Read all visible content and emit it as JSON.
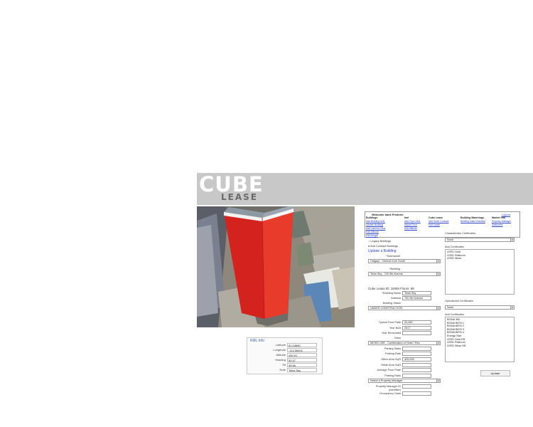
{
  "brand": {
    "word1": "CUBE",
    "word2": "LEASE"
  },
  "kml": {
    "title": "KML Info",
    "rows": [
      {
        "label": "Latitude",
        "value": "51.04660"
      },
      {
        "label": "Longitude",
        "value": "-114.06401"
      },
      {
        "label": "Altitude",
        "value": "490.91"
      },
      {
        "label": "Heading",
        "value": "50.47"
      },
      {
        "label": "Tilt",
        "value": "45.66"
      },
      {
        "label": "Note",
        "value": "Telus Sky"
      }
    ]
  },
  "welcome": {
    "title": "Welcome back Frederic",
    "logout": "Logout",
    "columns": [
      {
        "heading": "Buildings",
        "links": [
          "Add Building KML",
          "Update Building",
          "Add Camera View",
          "Edit Altitude",
          "Edit Height"
        ]
      },
      {
        "heading": "kml",
        "links": [
          "Add Floor KML",
          "Adjust Floor",
          "Edit Altitude"
        ]
      },
      {
        "heading": "Cube Lease",
        "links": [
          "Add Suite Contract",
          "Edit Lease"
        ]
      },
      {
        "heading": "Building Matchings",
        "links": [
          "Building Data Checklist"
        ]
      },
      {
        "heading": "Market Info",
        "links": [
          "Property Manager",
          "Statement"
        ]
      }
    ]
  },
  "form": {
    "radio_legacy": "Legacy Buildings",
    "radio_cube": "Add Contract Buildings",
    "update_link": "Update a Building",
    "submarket_label": "*Submarket",
    "submarket_value": "Calgary - Central Core South",
    "building_label": "*Building",
    "building_value": "Telus Sky - 700 9th Avenue",
    "cube_lease_info": "Cube Lease ID: 16065 Floors: 58",
    "bname_label": "*Building Name",
    "bname_value": "Telus Sky",
    "address_label": "Address",
    "address_value": "700 9th Avenue",
    "status_label": "Building Status",
    "status_value": "UNDER CONSTRUCTION",
    "typical_label": "Typical Floor Plate",
    "typical_value": "20,450",
    "year_label": "Year Built",
    "year_value": "2017",
    "renovated_label": "Year Renovated",
    "class_label": "Class",
    "class_value": "MIXED USE - Combination of Hotel / Res",
    "parking_label": "Parking Stalls",
    "parking_rate_label": "Parking Rate",
    "office_label": "Office Area SqFt",
    "office_value": "429,000",
    "retail_label": "Retail Area SqFt",
    "storage_label": "Average Floor Plate",
    "ratio_label": "Parking Ratio",
    "pm_value": "Select a Property Manager",
    "pm_label": "Property Manager ID",
    "pm_label2": "(Identifier)",
    "occ_label": "Occupancy Costs"
  },
  "right": {
    "none_value": "None",
    "add_cert_label": "Add Certificates",
    "certs1": [
      "LEED Gold",
      "LEED Platinum",
      "LEED Silver"
    ],
    "char_label": "Characteristic Certificates",
    "char_label2": "Operational Certificates",
    "none_value2": "None",
    "add_cert_label2": "Add Certificates",
    "certs2": [
      "BOMA 360",
      "BOMA BESt 1",
      "BOMA BESt 2",
      "BOMA BESt 3",
      "BOMA BESt 4",
      "Energy Star",
      "LEED Gold EB",
      "LEED Platinum",
      "LEED Silver EB"
    ],
    "update_button": "Update"
  }
}
